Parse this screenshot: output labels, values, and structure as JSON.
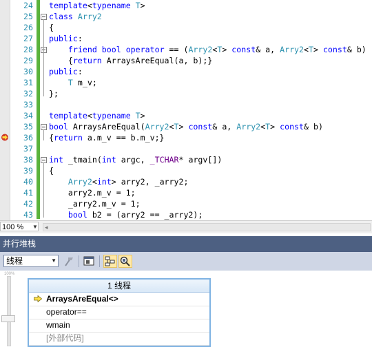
{
  "editor": {
    "lines": [
      {
        "num": "24",
        "fold": false,
        "html": "<span class=\"kw\">template</span>&lt;<span class=\"kw\">typename</span> <span class=\"ty\">T</span>&gt;"
      },
      {
        "num": "25",
        "fold": true,
        "html": "<span class=\"kw\">class</span> <span class=\"ty\">Arry2</span>"
      },
      {
        "num": "26",
        "fold": false,
        "html": "{"
      },
      {
        "num": "27",
        "fold": false,
        "html": "<span class=\"kw\">public</span>:"
      },
      {
        "num": "28",
        "fold": true,
        "html": "    <span class=\"kw\">friend</span> <span class=\"kw\">bool</span> <span class=\"kw\">operator</span> == (<span class=\"ty\">Arry2</span>&lt;<span class=\"ty\">T</span>&gt; <span class=\"kw\">const</span>&amp; a, <span class=\"ty\">Arry2</span>&lt;<span class=\"ty\">T</span>&gt; <span class=\"kw\">const</span>&amp; b)"
      },
      {
        "num": "29",
        "fold": false,
        "html": "    {<span class=\"kw\">return</span> ArraysAreEqual(a, b);}"
      },
      {
        "num": "30",
        "fold": false,
        "html": "<span class=\"kw\">public</span>:"
      },
      {
        "num": "31",
        "fold": false,
        "html": "    <span class=\"ty\">T</span> m_v;"
      },
      {
        "num": "32",
        "fold": false,
        "html": "};"
      },
      {
        "num": "33",
        "fold": false,
        "html": ""
      },
      {
        "num": "34",
        "fold": false,
        "html": "<span class=\"kw\">template</span>&lt;<span class=\"kw\">typename</span> <span class=\"ty\">T</span>&gt;"
      },
      {
        "num": "35",
        "fold": true,
        "html": "<span class=\"kw\">bool</span> ArraysAreEqual(<span class=\"ty\">Arry2</span>&lt;<span class=\"ty\">T</span>&gt; <span class=\"kw\">const</span>&amp; a, <span class=\"ty\">Arry2</span>&lt;<span class=\"ty\">T</span>&gt; <span class=\"kw\">const</span>&amp; b)"
      },
      {
        "num": "36",
        "fold": false,
        "html": "{<span class=\"kw\">return</span> a.m_v == b.m_v;}"
      },
      {
        "num": "37",
        "fold": false,
        "html": ""
      },
      {
        "num": "38",
        "fold": true,
        "html": "<span class=\"kw\">int</span> _tmain(<span class=\"kw\">int</span> argc, <span class=\"mac\">_TCHAR</span>* argv[])"
      },
      {
        "num": "39",
        "fold": false,
        "html": "{"
      },
      {
        "num": "40",
        "fold": false,
        "html": "    <span class=\"ty\">Arry2</span>&lt;<span class=\"kw\">int</span>&gt; arry2, _arry2;"
      },
      {
        "num": "41",
        "fold": false,
        "html": "    arry2.m_v = 1;"
      },
      {
        "num": "42",
        "fold": false,
        "html": "    _arry2.m_v = 1;"
      },
      {
        "num": "43",
        "fold": false,
        "html": "    <span class=\"kw\">bool</span> b2 = (arry2 == _arry2);"
      }
    ]
  },
  "status": {
    "zoom": "100 %"
  },
  "panel": {
    "title": "并行堆栈",
    "mode_value": "线程",
    "icons": [
      "flag-icon",
      "thread-view-icon",
      "method-view-icon",
      "zoom-to-frame-icon"
    ]
  },
  "stack": {
    "header": "1 线程",
    "frames": [
      "ArraysAreEqual<>",
      "operator==",
      "wmain",
      "[外部代码]"
    ]
  },
  "slider": {
    "label": "100%",
    "level": 0.6
  },
  "colors": {
    "title_bar": "#4d6082",
    "toolbar": "#cfd6e5",
    "change_bar": "#5ab33c",
    "stack_border": "#7fb3e3"
  }
}
